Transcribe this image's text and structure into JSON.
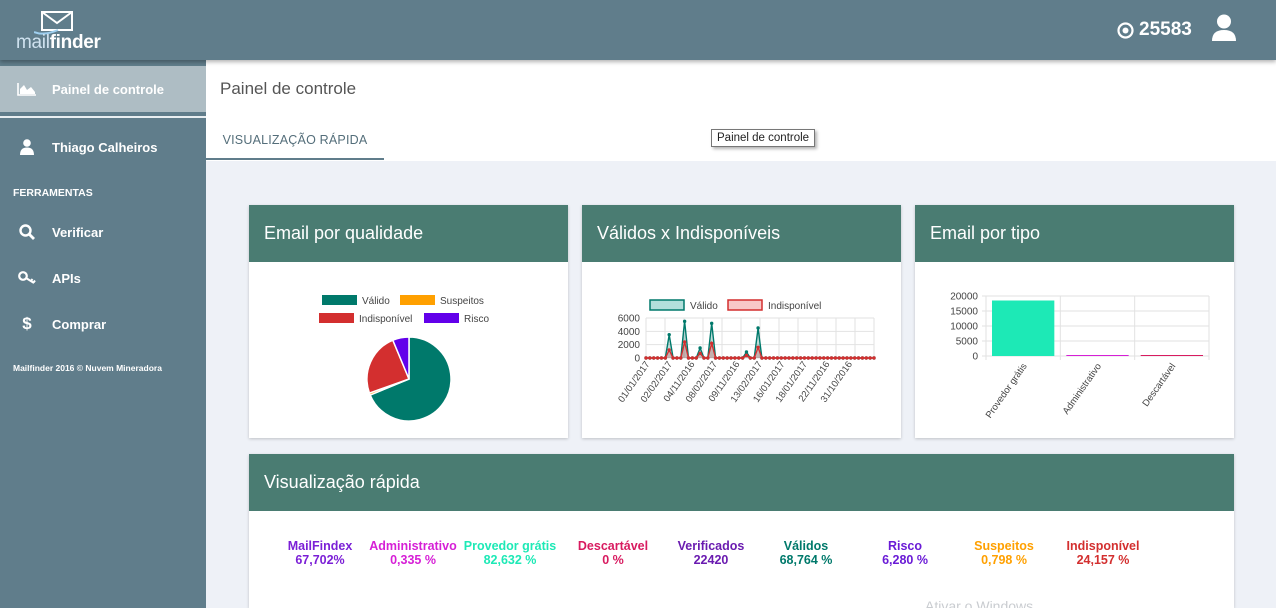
{
  "app": {
    "logo_light": "mail",
    "logo_bold": "finder",
    "credits": "25583"
  },
  "sidebar": {
    "dashboard": "Painel de controle",
    "user": "Thiago Calheiros",
    "section": "FERRAMENTAS",
    "verify": "Verificar",
    "apis": "APIs",
    "buy": "Comprar",
    "footer": "Mailfinder 2016 © Nuvem Mineradora"
  },
  "header": {
    "title": "Painel de controle",
    "tab": "VISUALIZAÇÃO RÁPIDA",
    "tooltip": "Painel de controle"
  },
  "cards": {
    "quality": "Email por qualidade",
    "valid_vs": "Válidos x Indisponíveis",
    "type": "Email por tipo",
    "quick": "Visualização rápida"
  },
  "stats": [
    {
      "label": "MailFindex",
      "value": "67,702%",
      "color": "#7b1fd6"
    },
    {
      "label": "Administrativo",
      "value": "0,335 %",
      "color": "#d61fd6"
    },
    {
      "label": "Provedor grátis",
      "value": "82,632 %",
      "color": "#1de9b6"
    },
    {
      "label": "Descartável",
      "value": "0 %",
      "color": "#d81b60"
    },
    {
      "label": "Verificados",
      "value": "22420",
      "color": "#6a1bb0"
    },
    {
      "label": "Válidos",
      "value": "68,764 %",
      "color": "#00796b"
    },
    {
      "label": "Risco",
      "value": "6,280 %",
      "color": "#6a1bd6"
    },
    {
      "label": "Suspeitos",
      "value": "0,798 %",
      "color": "#ffa000"
    },
    {
      "label": "Indisponível",
      "value": "24,157 %",
      "color": "#d32f2f"
    }
  ],
  "faded_text": "Ativar o Windows",
  "chart_data": [
    {
      "type": "pie",
      "title": "Email por qualidade",
      "labels": [
        "Válido",
        "Suspeitos",
        "Indisponível",
        "Risco"
      ],
      "values": [
        68.764,
        0.798,
        24.157,
        6.28
      ],
      "colors": [
        "#00796b",
        "#ffa000",
        "#d32f2f",
        "#6200ea"
      ]
    },
    {
      "type": "line",
      "title": "Válidos x Indisponíveis",
      "x_tick_labels": [
        "01/01/2017",
        "02/02/2017",
        "04/11/2016",
        "08/02/2017",
        "09/11/2016",
        "13/02/2017",
        "16/01/2017",
        "18/01/2017",
        "22/11/2016",
        "31/10/2016"
      ],
      "ylim": [
        0,
        6000
      ],
      "y_ticks": [
        0,
        2000,
        4000,
        6000
      ],
      "series": [
        {
          "name": "Válido",
          "color": "#00796b",
          "values": [
            0,
            0,
            0,
            0,
            0,
            0,
            3500,
            0,
            0,
            0,
            5500,
            0,
            0,
            0,
            1500,
            0,
            0,
            5200,
            0,
            0,
            0,
            0,
            0,
            0,
            0,
            0,
            900,
            0,
            0,
            4500,
            0,
            0,
            0,
            0,
            0,
            0,
            0,
            0,
            0,
            0,
            0,
            0,
            0,
            0,
            0,
            0,
            0,
            0,
            0,
            0,
            0,
            0,
            0,
            0,
            0,
            0,
            0,
            0,
            0,
            0
          ]
        },
        {
          "name": "Indisponível",
          "color": "#d32f2f",
          "values": [
            0,
            0,
            0,
            0,
            0,
            0,
            1200,
            0,
            0,
            0,
            2400,
            0,
            0,
            0,
            700,
            0,
            0,
            2200,
            0,
            0,
            0,
            0,
            0,
            0,
            0,
            0,
            400,
            0,
            0,
            1600,
            0,
            0,
            0,
            0,
            0,
            0,
            0,
            0,
            0,
            0,
            0,
            0,
            0,
            0,
            0,
            0,
            0,
            0,
            0,
            0,
            0,
            0,
            0,
            0,
            0,
            0,
            0,
            0,
            0,
            0
          ]
        }
      ]
    },
    {
      "type": "bar",
      "title": "Email por tipo",
      "categories": [
        "Provedor grátis",
        "Administrativo",
        "Descartável"
      ],
      "values": [
        18500,
        75,
        0
      ],
      "colors": [
        "#1de9b6",
        "#d61fd6",
        "#d81b60"
      ],
      "ylim": [
        0,
        20000
      ],
      "y_ticks": [
        0,
        5000,
        10000,
        15000,
        20000
      ]
    }
  ]
}
